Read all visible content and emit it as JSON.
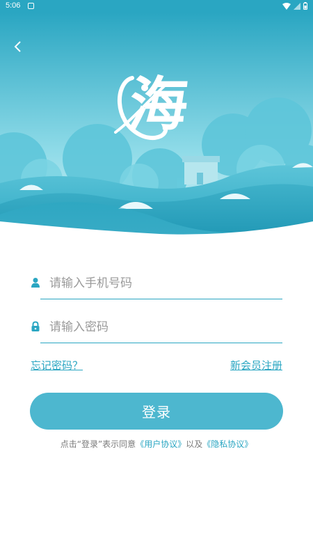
{
  "status_bar": {
    "time": "5:06",
    "icons": [
      "notification-icon",
      "wifi-icon",
      "signal-icon",
      "battery-icon"
    ]
  },
  "header": {
    "back_icon": "chevron-left-icon",
    "logo_text": "海"
  },
  "form": {
    "phone": {
      "placeholder": "请输入手机号码",
      "value": "",
      "icon": "person-icon"
    },
    "password": {
      "placeholder": "请输入密码",
      "value": "",
      "icon": "lock-icon"
    }
  },
  "links": {
    "forgot_password": "忘记密码？",
    "register": "新会员注册"
  },
  "login_button": "登录",
  "agreement": {
    "prefix": "点击“登录”表示同意",
    "user_agreement": "《用户协议》",
    "middle": "以及",
    "privacy_policy": "《隐私协议》"
  },
  "colors": {
    "accent": "#2aa6c2",
    "button": "#4db7cf",
    "sky_top": "#2aa6c2",
    "sky_bottom": "#8fdbe8"
  }
}
